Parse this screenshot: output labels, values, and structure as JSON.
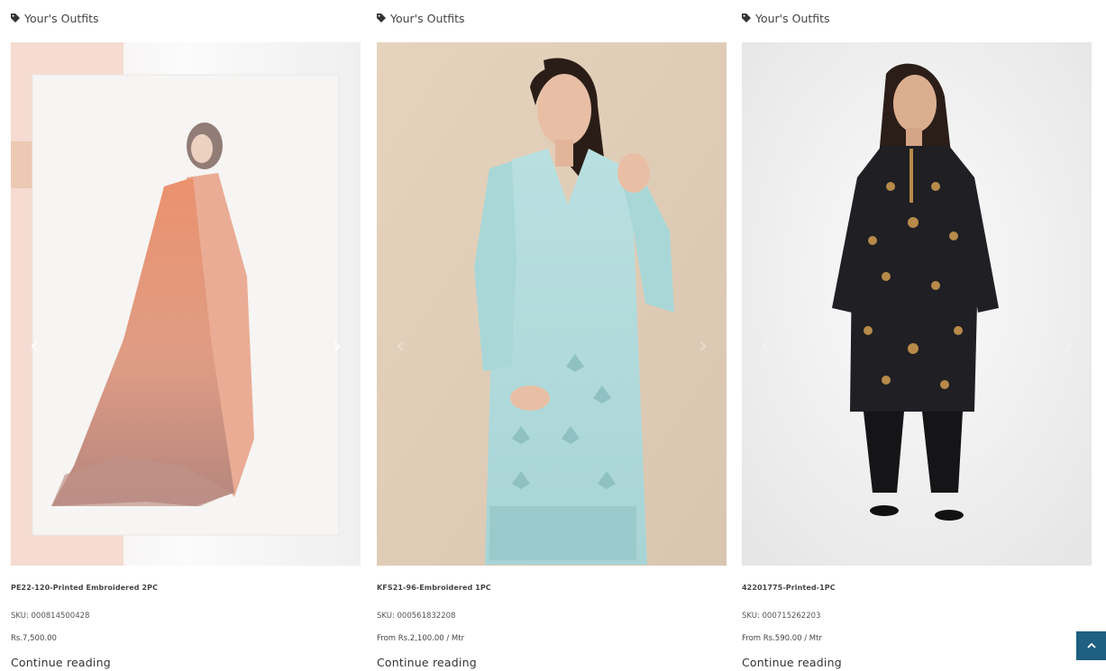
{
  "products": [
    {
      "category": "Your's Outfits",
      "name": "PE22-120-Printed Embroidered 2PC",
      "sku": "SKU: 000814500428",
      "price": "Rs.7,500.00",
      "more": "Continue reading"
    },
    {
      "category": "Your's Outfits",
      "name": "KFS21-96-Embroidered 1PC",
      "sku": "SKU: 000561832208",
      "price": "From Rs.2,100.00 / Mtr",
      "more": "Continue reading"
    },
    {
      "category": "Your's Outfits",
      "name": "42201775-Printed-1PC",
      "sku": "SKU: 000715262203",
      "price": "From Rs.590.00 / Mtr",
      "more": "Continue reading"
    }
  ],
  "icons": {
    "category": "tag-icon",
    "prev": "chevron-left-icon",
    "next": "chevron-right-icon",
    "back_to_top": "chevron-up-icon"
  },
  "colors": {
    "back_to_top_bg": "#1e5f82",
    "link_text": "#333333"
  }
}
